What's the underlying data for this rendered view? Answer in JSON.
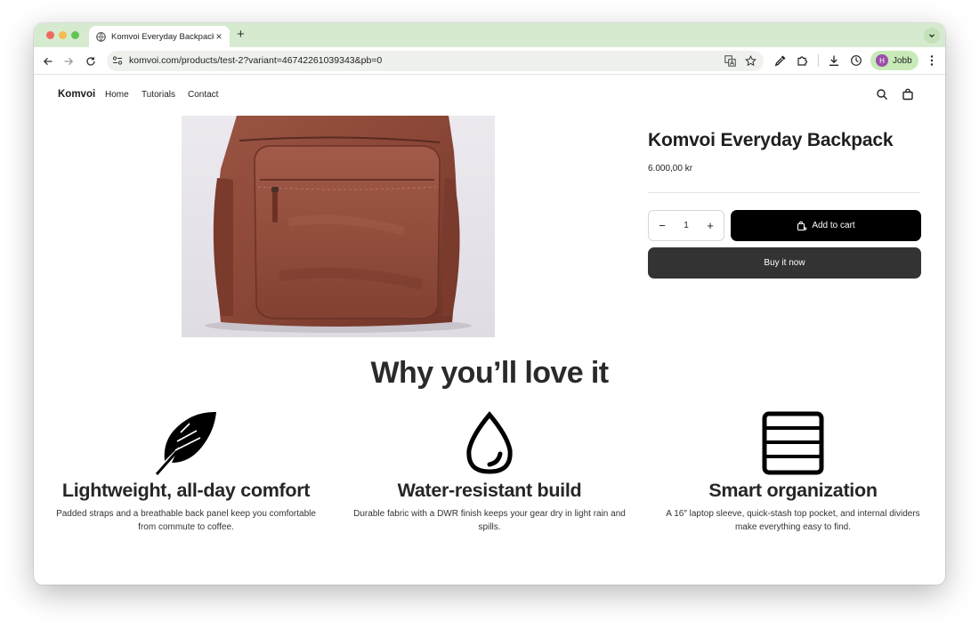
{
  "browser": {
    "tab_title": "Komvoi Everyday Backpack",
    "tab_close": "×",
    "new_tab": "+",
    "url": "komvoi.com/products/test-2?variant=46742261039343&pb=0",
    "profile_initial": "H",
    "profile_name": "Jobb"
  },
  "site": {
    "logo": "Komvoi",
    "nav": [
      "Home",
      "Tutorials",
      "Contact"
    ]
  },
  "product": {
    "title": "Komvoi Everyday Backpack",
    "price": "6.000,00 kr",
    "quantity": "1",
    "qty_minus": "−",
    "qty_plus": "+",
    "add_to_cart": "Add to cart",
    "buy_now": "Buy it now"
  },
  "features": {
    "heading": "Why you’ll love it",
    "items": [
      {
        "icon": "feather-icon",
        "title": "Lightweight, all-day comfort",
        "desc": "Padded straps and a breathable back panel keep you comfortable from commute to coffee."
      },
      {
        "icon": "water-drop-icon",
        "title": "Water-resistant build",
        "desc": "Durable fabric with a DWR finish keeps your gear dry in light rain and spills."
      },
      {
        "icon": "organizer-icon",
        "title": "Smart organization",
        "desc": "A 16″ laptop sleeve, quick-stash top pocket, and internal dividers make everything easy to find."
      }
    ]
  },
  "colors": {
    "tab_strip": "#d6ead0",
    "profile_chip": "#c8eab9",
    "add_to_cart_bg": "#000000",
    "buy_now_bg": "#333333",
    "backpack_leather": "#8a4636"
  }
}
